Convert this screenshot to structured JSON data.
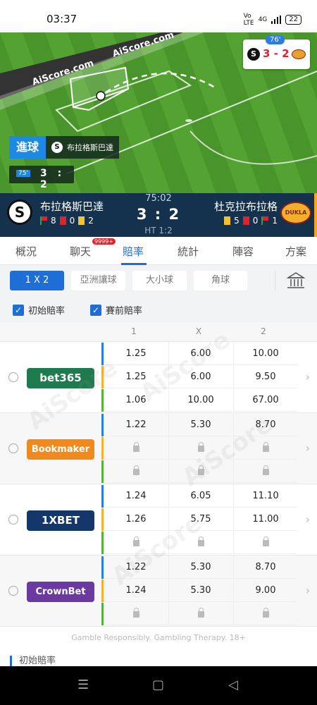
{
  "status": {
    "time": "03:37",
    "network": "4G",
    "battery": "22"
  },
  "field": {
    "brand_top": "AiScore.com",
    "brand_bottom": "AiScore.com",
    "live_minute": "76'",
    "live_score": "3 - 2",
    "goal_label": "進球",
    "goal_team": "布拉格斯巴達",
    "minute_badge": "75'",
    "minute_score": "3 : 2"
  },
  "match": {
    "home_name": "布拉格斯巴達",
    "home_corners": "8",
    "home_red": "0",
    "home_yellow": "2",
    "clock": "75:02",
    "score": "3 : 2",
    "ht": "HT 1:2",
    "away_name": "杜克拉布拉格",
    "away_yellow": "5",
    "away_red": "0",
    "away_corners": "1",
    "home_logo": "S",
    "away_logo": "DUKLA"
  },
  "tabs": {
    "items": [
      "概況",
      "聊天",
      "賠率",
      "統計",
      "陣容",
      "方案"
    ],
    "chat_badge": "9999+",
    "active": "賠率"
  },
  "filters": {
    "options": [
      "1 X 2",
      "亞洲讓球",
      "大小球",
      "角球"
    ],
    "checks": [
      "初始賠率",
      "賽前賠率"
    ]
  },
  "table": {
    "headers": [
      "1",
      "X",
      "2"
    ],
    "books": [
      {
        "name": "bet365",
        "rows": [
          [
            "1.25",
            "6.00",
            "10.00"
          ],
          [
            "1.25",
            "6.00",
            "9.50"
          ],
          [
            "1.06",
            "10.00",
            "67.00"
          ]
        ]
      },
      {
        "name": "Bookmaker",
        "rows": [
          [
            "1.22",
            "5.30",
            "8.70"
          ],
          [
            "lock",
            "lock",
            "lock"
          ],
          [
            "lock",
            "lock",
            "lock"
          ]
        ]
      },
      {
        "name": "1XBET",
        "rows": [
          [
            "1.24",
            "6.05",
            "11.10"
          ],
          [
            "1.26",
            "5.75",
            "11.00"
          ],
          [
            "lock",
            "lock",
            "lock"
          ]
        ]
      },
      {
        "name": "CrownBet",
        "rows": [
          [
            "1.22",
            "5.30",
            "8.70"
          ],
          [
            "1.24",
            "5.30",
            "9.00"
          ],
          [
            "lock",
            "lock",
            "lock"
          ]
        ]
      }
    ]
  },
  "footer": {
    "gamble": "Gamble Responsibly. Gambling Therapy. 18+",
    "section": "初始賠率"
  },
  "colors": {
    "accent": "#1e6ed6",
    "header_bg": "#14324d",
    "field": "#4e9a2e",
    "score_red": "#e0232b"
  }
}
